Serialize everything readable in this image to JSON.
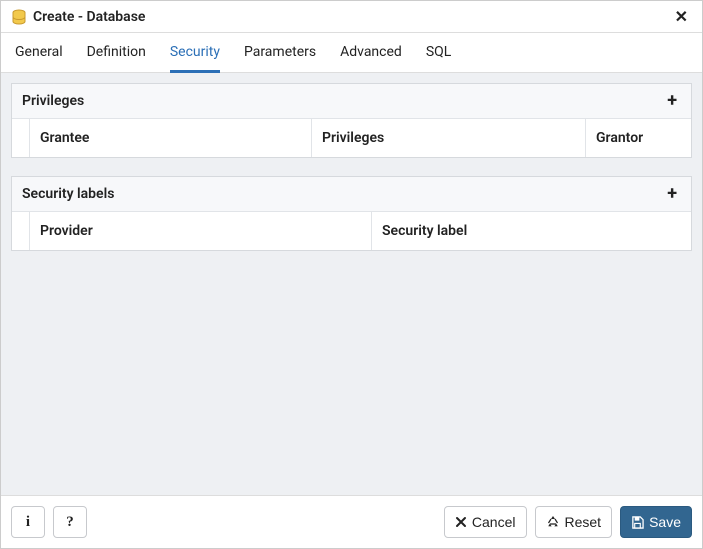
{
  "header": {
    "title": "Create - Database"
  },
  "tabs": {
    "general": "General",
    "definition": "Definition",
    "security": "Security",
    "parameters": "Parameters",
    "advanced": "Advanced",
    "sql": "SQL",
    "active": "security"
  },
  "privileges": {
    "title": "Privileges",
    "columns": {
      "grantee": "Grantee",
      "privileges": "Privileges",
      "grantor": "Grantor"
    },
    "rows": []
  },
  "security_labels": {
    "title": "Security labels",
    "columns": {
      "provider": "Provider",
      "security_label": "Security label"
    },
    "rows": []
  },
  "footer": {
    "cancel": "Cancel",
    "reset": "Reset",
    "save": "Save"
  }
}
